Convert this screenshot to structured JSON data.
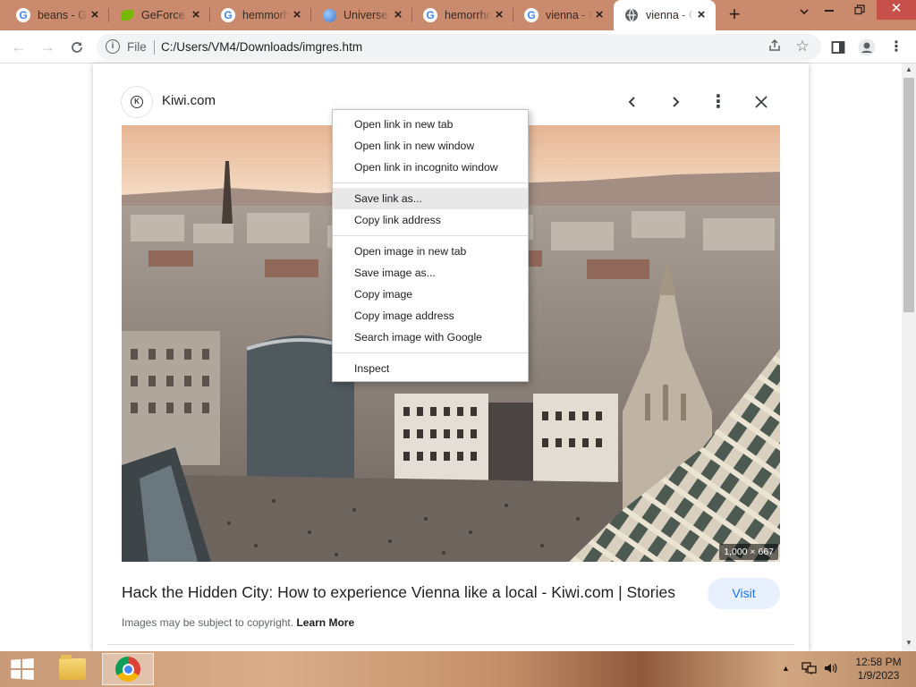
{
  "browser": {
    "tabs": [
      {
        "title": "beans - Google Search",
        "favicon": "google-icon"
      },
      {
        "title": "GeForce Experience",
        "favicon": "nvidia-icon"
      },
      {
        "title": "hemmorhoids - Google Search",
        "favicon": "google-icon"
      },
      {
        "title": "Universe",
        "favicon": "globe-icon"
      },
      {
        "title": "hemorrhoids - Google Search",
        "favicon": "google-icon"
      },
      {
        "title": "vienna - Google Search",
        "favicon": "google-icon"
      },
      {
        "title": "vienna - Google Search",
        "favicon": "globe-icon",
        "active": true
      }
    ],
    "omnibox": {
      "scheme_label": "File",
      "url": "C:/Users/VM4/Downloads/imgres.htm"
    }
  },
  "viewer": {
    "source_name": "Kiwi.com",
    "image_dimensions": "1,000 × 667",
    "caption": "Hack the Hidden City: How to experience Vienna like a local - Kiwi.com | Stories",
    "visit_label": "Visit",
    "copyright_text": "Images may be subject to copyright.",
    "learn_more": "Learn More"
  },
  "context_menu": {
    "groups": [
      [
        "Open link in new tab",
        "Open link in new window",
        "Open link in incognito window"
      ],
      [
        "Save link as...",
        "Copy link address"
      ],
      [
        "Open image in new tab",
        "Save image as...",
        "Copy image",
        "Copy image address",
        "Search image with Google"
      ],
      [
        "Inspect"
      ]
    ],
    "highlighted": "Save link as..."
  },
  "taskbar": {
    "time": "12:58 PM",
    "date": "1/9/2023"
  },
  "colors": {
    "tabstrip": "#c98a6e",
    "accent": "#1a73e8",
    "visit_bg": "#e8f0fe"
  }
}
